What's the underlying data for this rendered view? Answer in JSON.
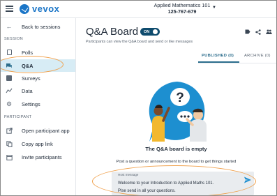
{
  "app": {
    "logo_text": "vevox"
  },
  "session": {
    "title": "Applied Mathematics 101",
    "code": "125-767-679"
  },
  "sidebar": {
    "back_label": "Back to sessions",
    "section_session": "SESSION",
    "section_participant": "PARTICIPANT",
    "items": [
      {
        "label": "Polls",
        "icon": "polls-icon"
      },
      {
        "label": "Q&A",
        "icon": "qa-chat-icon",
        "active": true
      },
      {
        "label": "Surveys",
        "icon": "surveys-icon"
      },
      {
        "label": "Data",
        "icon": "data-chart-icon"
      },
      {
        "label": "Settings",
        "icon": "gear-icon"
      }
    ],
    "participant_items": [
      {
        "label": "Open participant app",
        "icon": "open-external-icon"
      },
      {
        "label": "Copy app link",
        "icon": "copy-icon"
      },
      {
        "label": "Invite participants",
        "icon": "invite-icon"
      }
    ]
  },
  "main": {
    "title": "Q&A Board",
    "toggle_label": "ON",
    "subtitle": "Participants can view the Q&A board and send or like messages",
    "tabs": [
      {
        "label": "PUBLISHED (0)",
        "selected": true
      },
      {
        "label": "ARCHIVE (0)",
        "selected": false
      }
    ],
    "empty_title": "The Q&A board is empty",
    "empty_subtitle": "Post a question or announcement to the board to get things started",
    "host_message": {
      "label": "Host message",
      "line1": "Welcome to your Introduction to Applied Maths 101.",
      "line2": "Plse send in all your questions."
    }
  },
  "colors": {
    "brand": "#1a75c7",
    "accent": "#2b6d8c",
    "toggle": "#0f4c6e",
    "active_row": "#d7ecf5",
    "highlight": "#f0a04b"
  }
}
